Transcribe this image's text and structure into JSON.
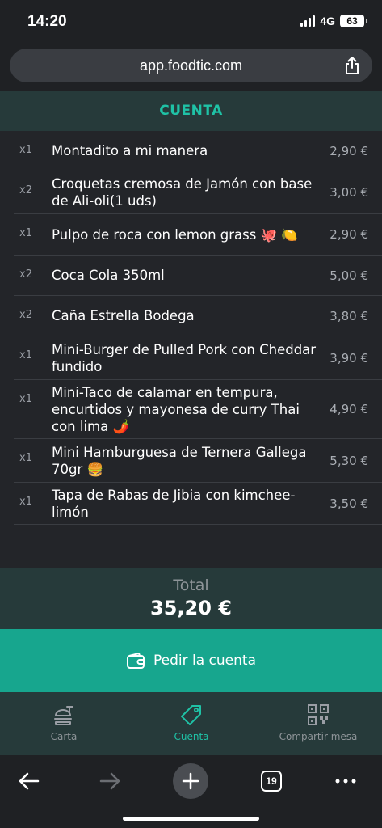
{
  "status_bar": {
    "time": "14:20",
    "network": "4G",
    "battery": "63"
  },
  "browser": {
    "url": "app.foodtic.com",
    "tabs_count": "19"
  },
  "header": {
    "title": "CUENTA"
  },
  "items": [
    {
      "qty": "x1",
      "name": "Montadito a mi manera",
      "price": "2,90 €"
    },
    {
      "qty": "x2",
      "name": "Croquetas cremosa de Jamón con base de Ali-oli(1 uds)",
      "price": "3,00 €"
    },
    {
      "qty": "x1",
      "name": "Pulpo de roca con lemon grass 🐙 🍋",
      "price": "2,90 €"
    },
    {
      "qty": "x2",
      "name": "Coca Cola 350ml",
      "price": "5,00 €"
    },
    {
      "qty": "x2",
      "name": "Caña Estrella Bodega",
      "price": "3,80 €"
    },
    {
      "qty": "x1",
      "name": "Mini-Burger de Pulled Pork con Cheddar fundido",
      "price": "3,90 €"
    },
    {
      "qty": "x1",
      "name": "Mini-Taco de calamar en tempura, encurtidos y mayonesa de curry Thai con lima 🌶️",
      "price": "4,90 €"
    },
    {
      "qty": "x1",
      "name": "Mini Hamburguesa de Ternera Gallega 70gr 🍔",
      "price": "5,30 €"
    },
    {
      "qty": "x1",
      "name": "Tapa de Rabas de Jibia con kimchee-limón",
      "price": "3,50 €"
    }
  ],
  "total": {
    "label": "Total",
    "value": "35,20 €"
  },
  "pay_button": {
    "label": "Pedir la cuenta"
  },
  "tabs": [
    {
      "label": "Carta",
      "icon": "burger-icon"
    },
    {
      "label": "Cuenta",
      "icon": "tag-icon",
      "active": true
    },
    {
      "label": "Compartir mesa",
      "icon": "qr-code-icon"
    }
  ],
  "colors": {
    "accent": "#1fc2a6",
    "button": "#17a68e",
    "background": "#232529",
    "panel": "#263a3a"
  }
}
